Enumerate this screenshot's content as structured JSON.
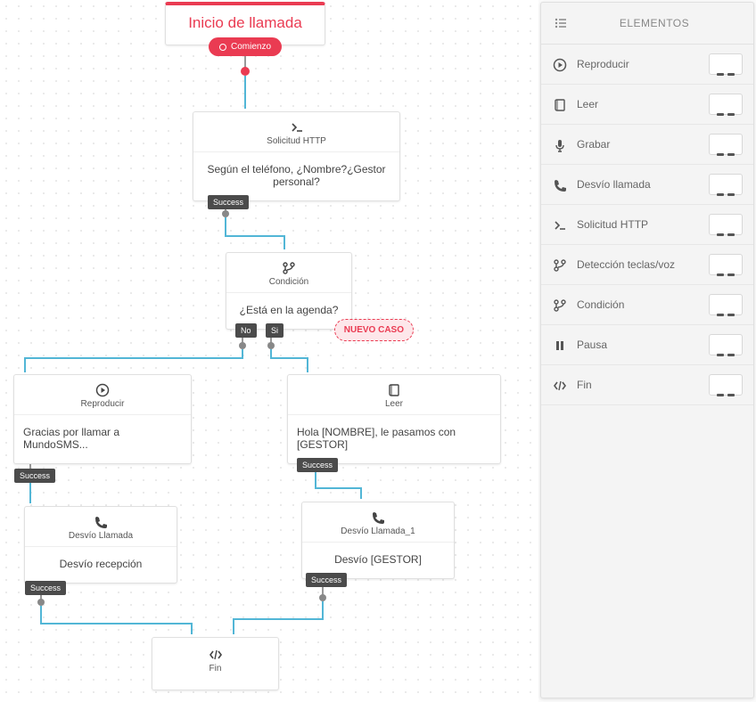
{
  "start": {
    "title": "Inicio de llamada",
    "pill": "Comienzo"
  },
  "http": {
    "label": "Solicitud HTTP",
    "body": "Según el teléfono, ¿Nombre?¿Gestor personal?",
    "tag": "Success"
  },
  "cond": {
    "label": "Condición",
    "body": "¿Está en la agenda?",
    "no": "No",
    "si": "Si",
    "new": "NUEVO CASO"
  },
  "play": {
    "label": "Reproducir",
    "body": "Gracias por llamar a MundoSMS...",
    "tag": "Success"
  },
  "read": {
    "label": "Leer",
    "body": "Hola [NOMBRE], le pasamos con [GESTOR]",
    "tag": "Success"
  },
  "fwd1": {
    "label": "Desvío Llamada",
    "body": "Desvío recepción",
    "tag": "Success"
  },
  "fwd2": {
    "label": "Desvío Llamada_1",
    "body": "Desvío [GESTOR]",
    "tag": "Success"
  },
  "end": {
    "label": "Fin"
  },
  "sidebar": {
    "title": "ELEMENTOS",
    "items": [
      {
        "label": "Reproducir",
        "icon": "play"
      },
      {
        "label": "Leer",
        "icon": "book"
      },
      {
        "label": "Grabar",
        "icon": "mic"
      },
      {
        "label": "Desvío llamada",
        "icon": "phone"
      },
      {
        "label": "Solicitud HTTP",
        "icon": "cmd"
      },
      {
        "label": "Detección teclas/voz",
        "icon": "branch"
      },
      {
        "label": "Condición",
        "icon": "branch"
      },
      {
        "label": "Pausa",
        "icon": "pause"
      },
      {
        "label": "Fin",
        "icon": "code"
      }
    ]
  }
}
